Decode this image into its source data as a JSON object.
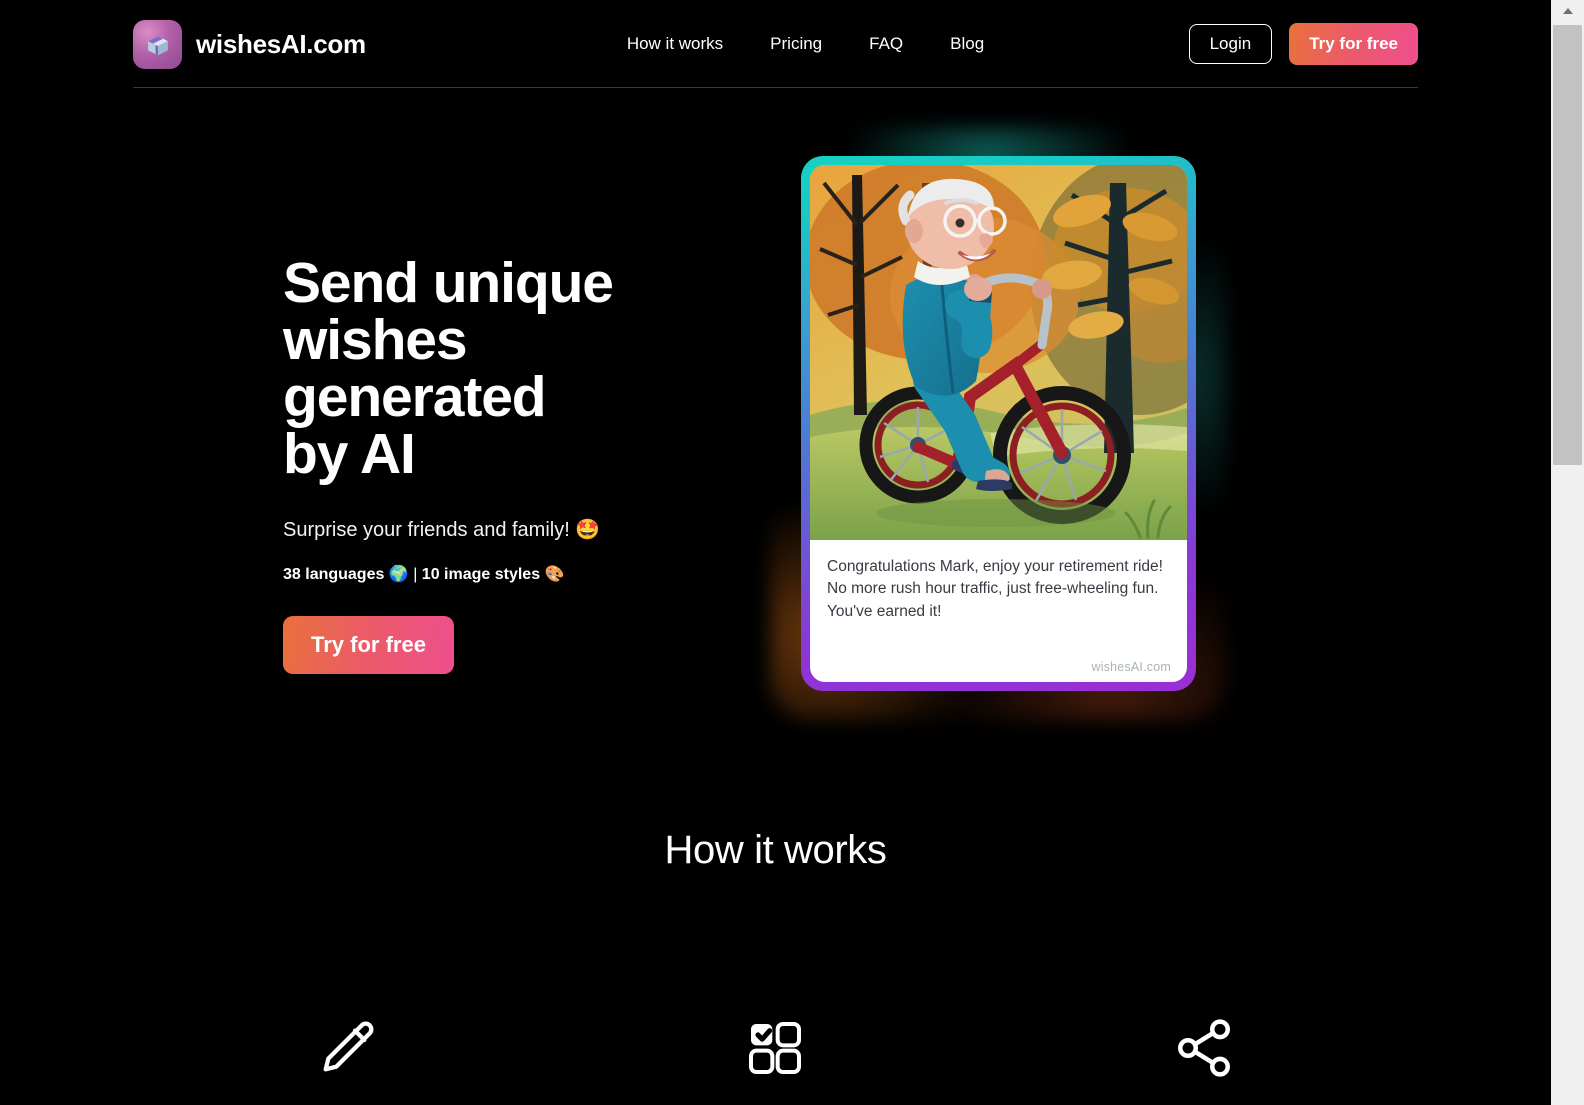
{
  "header": {
    "brand_name": "wishesAI.com",
    "logo_icon": "gift-box-icon",
    "nav": [
      {
        "label": "How it works"
      },
      {
        "label": "Pricing"
      },
      {
        "label": "FAQ"
      },
      {
        "label": "Blog"
      }
    ],
    "login_label": "Login",
    "cta_label": "Try for free"
  },
  "hero": {
    "title_line1": "Send unique",
    "title_line2": "wishes generated",
    "title_line3": "by AI",
    "subtitle": "Surprise your friends and family! 🤩",
    "meta_languages": "38 languages 🌍",
    "meta_separator": " | ",
    "meta_styles": "10 image styles 🎨",
    "cta_label": "Try for free"
  },
  "card": {
    "message": "Congratulations Mark, enjoy your retirement ride! No more rush hour traffic, just free-wheeling fun. You've earned it!",
    "watermark": "wishesAI.com",
    "art_description": "Illustrated elderly man in teal tracksuit riding a red tricycle on green grass with autumn trees"
  },
  "how_it_works": {
    "title": "How it works",
    "steps": [
      {
        "icon": "pencil-icon"
      },
      {
        "icon": "grid-check-icon"
      },
      {
        "icon": "share-icon"
      }
    ]
  },
  "colors": {
    "background": "#000000",
    "accent_orange": "#e8713c",
    "accent_pink": "#ef4f8e",
    "card_border_start": "#16d2c0",
    "card_border_mid": "#4a7fd4",
    "card_border_end": "#9b2fd4",
    "text_primary": "#ffffff"
  },
  "scrollbar": {
    "position": "top"
  }
}
